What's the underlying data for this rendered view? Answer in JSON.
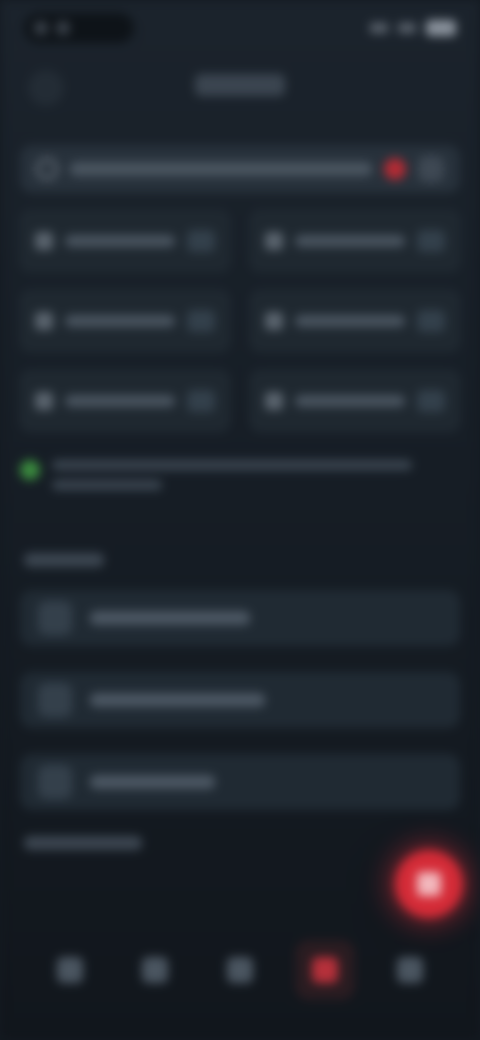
{
  "app": {
    "accent_color": "#d42b37"
  },
  "status_bar": {
    "icons": [
      "signal-icon",
      "wifi-icon",
      "battery-icon"
    ]
  },
  "header": {
    "title": ""
  },
  "search": {
    "placeholder": "",
    "icon": "search-icon"
  },
  "grid": {
    "tiles": [
      {
        "label": ""
      },
      {
        "label": ""
      },
      {
        "label": ""
      },
      {
        "label": ""
      },
      {
        "label": ""
      },
      {
        "label": ""
      }
    ]
  },
  "notice": {
    "icon": "check-circle-icon",
    "text": ""
  },
  "section_1": {
    "label": ""
  },
  "list": {
    "items": [
      {
        "label": "",
        "icon": "document-icon"
      },
      {
        "label": "",
        "icon": "document-icon"
      },
      {
        "label": "",
        "icon": "document-icon"
      }
    ]
  },
  "section_2": {
    "label": ""
  },
  "fab": {
    "icon": "plus-icon"
  },
  "bottom_nav": {
    "items": [
      {
        "icon": "home-icon"
      },
      {
        "icon": "grid-icon"
      },
      {
        "icon": "list-icon"
      },
      {
        "icon": "record-icon",
        "active": true
      },
      {
        "icon": "profile-icon"
      }
    ]
  }
}
